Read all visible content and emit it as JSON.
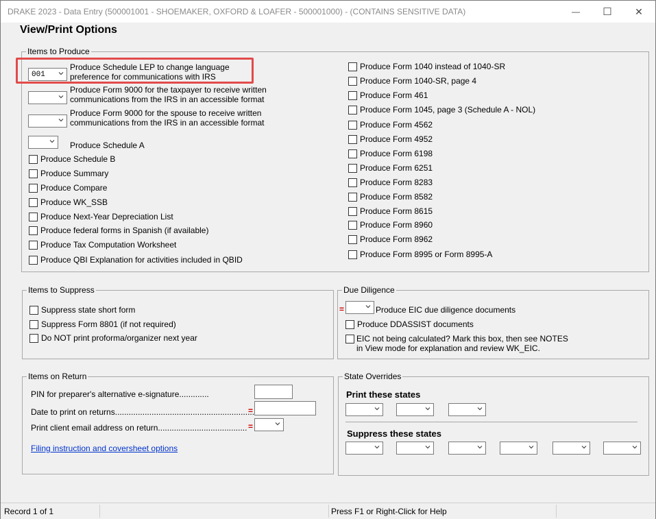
{
  "window": {
    "title": "DRAKE 2023 - Data Entry (500001001 - SHOEMAKER, OXFORD & LOAFER - 500001000) - (CONTAINS SENSITIVE DATA)",
    "controls": {
      "minimize": "—",
      "maximize": "☐",
      "close": "✕"
    }
  },
  "page_title": "View/Print Options",
  "items_to_produce": {
    "label": "Items to Produce",
    "lep": {
      "value": "001",
      "line1": "Produce Schedule LEP to change language",
      "line2": "preference for communications with IRS"
    },
    "form9000_taxpayer": {
      "line1": "Produce Form 9000 for the taxpayer to receive written",
      "line2": "communications from the IRS in an accessible format"
    },
    "form9000_spouse": {
      "line1": "Produce Form 9000 for the spouse to receive written",
      "line2": "communications from the IRS in an accessible format"
    },
    "schedule_a": "Produce Schedule A",
    "left_checks": [
      "Produce Schedule B",
      "Produce Summary",
      "Produce Compare",
      "Produce WK_SSB",
      "Produce Next-Year Depreciation List",
      "Produce federal forms in Spanish (if available)",
      "Produce Tax Computation Worksheet",
      "Produce QBI Explanation for activities included in QBID"
    ],
    "right_checks": [
      "Produce Form 1040 instead of 1040-SR",
      "Produce Form 1040-SR, page 4",
      "Produce Form 461",
      "Produce Form 1045, page 3 (Schedule A - NOL)",
      "Produce Form 4562",
      "Produce Form 4952",
      "Produce Form 6198",
      "Produce Form 6251",
      "Produce Form 8283",
      "Produce Form 8582",
      "Produce Form 8615",
      "Produce Form 8960",
      "Produce Form 8962",
      "Produce Form 8995 or Form 8995-A"
    ]
  },
  "items_to_suppress": {
    "label": "Items to Suppress",
    "checks": [
      "Suppress state short form",
      "Suppress Form 8801 (if not required)",
      "Do NOT print proforma/organizer next year"
    ]
  },
  "due_diligence": {
    "label": "Due Diligence",
    "eic": "Produce EIC due diligence documents",
    "ddassist": "Produce DDASSIST documents",
    "eic_not_calc_line1": "EIC not being calculated? Mark this box, then see NOTES",
    "eic_not_calc_line2": "in View mode for explanation and review WK_EIC."
  },
  "items_on_return": {
    "label": "Items on Return",
    "pin": "PIN for preparer's alternative e-signature.............",
    "date": "Date to print on returns.............................................................",
    "email": "Print client email address on return.......................................",
    "link": "Filing instruction and coversheet options"
  },
  "state_overrides": {
    "label": "State Overrides",
    "print_heading": "Print these states",
    "suppress_heading": "Suppress these states"
  },
  "required_marker": "=",
  "status": {
    "record": "Record 1 of 1",
    "help": "Press F1 or Right-Click for Help"
  }
}
